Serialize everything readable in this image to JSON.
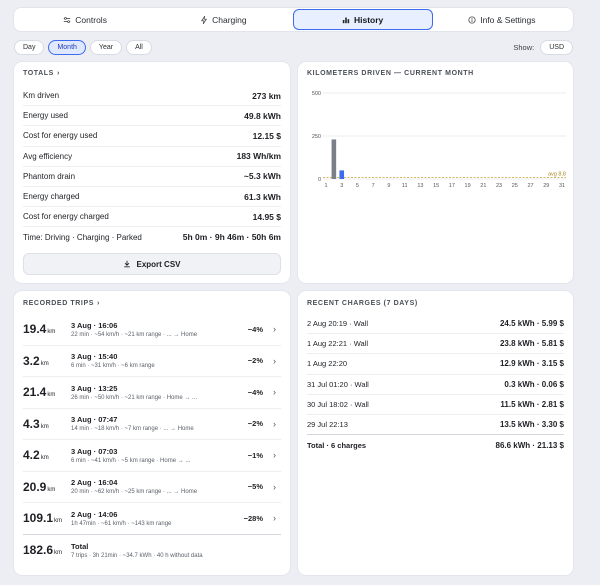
{
  "tabs": [
    {
      "label": "Controls",
      "icon": "sliders-icon"
    },
    {
      "label": "Charging",
      "icon": "bolt-icon"
    },
    {
      "label": "History",
      "icon": "bar-chart-icon"
    },
    {
      "label": "Info & Settings",
      "icon": "info-icon"
    }
  ],
  "filters": [
    "Day",
    "Month",
    "Year",
    "All"
  ],
  "show_label": "Show:",
  "currency": "USD",
  "totals": {
    "title": "TOTALS",
    "rows": [
      {
        "label": "Km driven",
        "value": "273 km"
      },
      {
        "label": "Energy used",
        "value": "49.8 kWh"
      },
      {
        "label": "Cost for energy used",
        "value": "12.15 $"
      },
      {
        "label": "Avg efficiency",
        "value": "183 Wh/km"
      },
      {
        "label": "Phantom drain",
        "value": "~5.3 kWh"
      },
      {
        "label": "Energy charged",
        "value": "61.3 kWh"
      },
      {
        "label": "Cost for energy charged",
        "value": "14.95 $"
      },
      {
        "label": "Time: Driving · Charging · Parked",
        "value": "5h 0m · 9h 46m · 50h 6m"
      }
    ],
    "export_label": "Export CSV"
  },
  "chart_data": {
    "type": "bar",
    "title": "KILOMETERS DRIVEN — CURRENT MONTH",
    "categories": [
      "1",
      "2",
      "3",
      "4",
      "5",
      "6",
      "7",
      "8",
      "9",
      "10",
      "11",
      "12",
      "13",
      "14",
      "15",
      "16",
      "17",
      "18",
      "19",
      "20",
      "21",
      "22",
      "23",
      "24",
      "25",
      "26",
      "27",
      "28",
      "29",
      "30",
      "31"
    ],
    "series": [
      {
        "values": [
          0,
          0,
          0,
          0,
          0,
          0,
          0,
          0,
          0,
          0,
          0,
          0,
          0,
          0,
          0,
          0,
          0,
          0,
          0,
          0,
          0,
          0,
          0,
          0,
          0,
          0,
          0,
          0,
          0,
          0,
          0,
          0
        ],
        "color": "#3d6bf0"
      }
    ],
    "bars": [
      {
        "day": 2,
        "value": 230,
        "color": "#7a7f8a"
      },
      {
        "day": 3,
        "value": 50,
        "color": "#3d6bf0"
      }
    ],
    "yticks": [
      0,
      250,
      500
    ],
    "ylim": [
      0,
      500
    ],
    "xticks": [
      "1",
      "3",
      "5",
      "7",
      "9",
      "11",
      "13",
      "15",
      "17",
      "19",
      "21",
      "23",
      "25",
      "27",
      "29",
      "31"
    ],
    "avg_label": "avg 8.8",
    "avg_value": 8.8,
    "grid": true
  },
  "trips": {
    "title": "RECORDED TRIPS",
    "items": [
      {
        "km": "19.4",
        "unit": "km",
        "time": "3 Aug · 16:06",
        "detail": "22 min · ~54 km/h · ~21 km range · ... → Home",
        "pct": "−4%"
      },
      {
        "km": "3.2",
        "unit": "km",
        "time": "3 Aug · 15:40",
        "detail": "6 min · ~31 km/h · ~6 km range",
        "pct": "−2%"
      },
      {
        "km": "21.4",
        "unit": "km",
        "time": "3 Aug · 13:25",
        "detail": "26 min · ~50 km/h · ~21 km range · Home → ...",
        "pct": "−4%"
      },
      {
        "km": "4.3",
        "unit": "km",
        "time": "3 Aug · 07:47",
        "detail": "14 min · ~18 km/h · ~7 km range · ... → Home",
        "pct": "−2%"
      },
      {
        "km": "4.2",
        "unit": "km",
        "time": "3 Aug · 07:03",
        "detail": "6 min · ~41 km/h · ~5 km range · Home → ...",
        "pct": "−1%"
      },
      {
        "km": "20.9",
        "unit": "km",
        "time": "2 Aug · 16:04",
        "detail": "20 min · ~62 km/h · ~25 km range · ... → Home",
        "pct": "−5%"
      },
      {
        "km": "109.1",
        "unit": "km",
        "time": "2 Aug · 14:06",
        "detail": "1h 47min · ~61 km/h · ~143 km range",
        "pct": "−28%"
      }
    ],
    "total": {
      "km": "182.6",
      "unit": "km",
      "label": "Total",
      "detail": "7 trips · 3h 21min · ~34.7 kWh · 40 h without data"
    }
  },
  "charges": {
    "title": "RECENT CHARGES (7 DAYS)",
    "items": [
      {
        "label": "2 Aug 20:19 · Wall",
        "value": "24.5 kWh · 5.99 $"
      },
      {
        "label": "1 Aug 22:21 · Wall",
        "value": "23.8 kWh · 5.81 $"
      },
      {
        "label": "1 Aug 22:20",
        "value": "12.9 kWh · 3.15 $"
      },
      {
        "label": "31 Jul 01:20 · Wall",
        "value": "0.3 kWh · 0.06 $"
      },
      {
        "label": "30 Jul 18:02 · Wall",
        "value": "11.5 kWh · 2.81 $"
      },
      {
        "label": "29 Jul 22:13",
        "value": "13.5 kWh · 3.30 $"
      }
    ],
    "total_label": "Total · 6 charges",
    "total_value": "86.6 kWh · 21.13 $"
  }
}
